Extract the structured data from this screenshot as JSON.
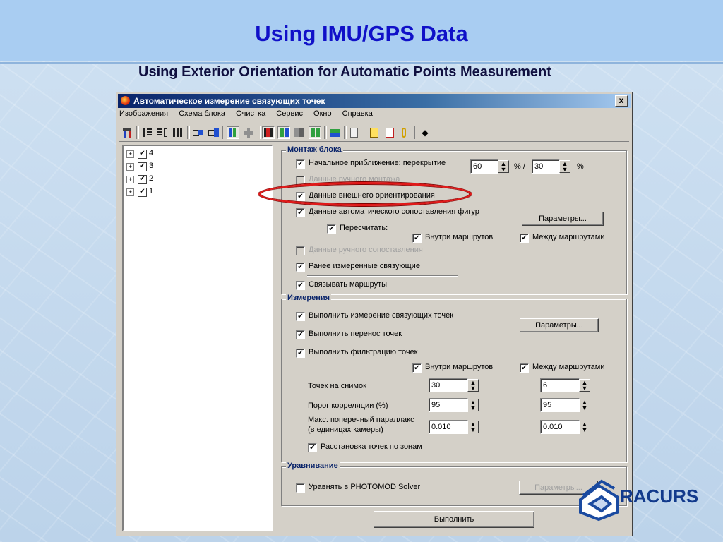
{
  "slide": {
    "title": "Using IMU/GPS Data",
    "subtitle": "Using Exterior Orientation for  Automatic Points Measurement"
  },
  "window": {
    "title": "Автоматическое измерение связующих точек",
    "close": "x",
    "menu": [
      "Изображения",
      "Схема блока",
      "Очистка",
      "Сервис",
      "Окно",
      "Справка"
    ]
  },
  "tree": [
    {
      "label": "4",
      "checked": true
    },
    {
      "label": "3",
      "checked": true
    },
    {
      "label": "2",
      "checked": true
    },
    {
      "label": "1",
      "checked": true
    }
  ],
  "mount": {
    "legend": "Монтаж блока",
    "initial_approx": "Начальное приближение: перекрытие",
    "overlap1": "60",
    "sep": "% /",
    "overlap2": "30",
    "pct": "%",
    "manual_mount": "Данные ручного монтажа",
    "exterior": "Данные внешнего ориентирования",
    "auto_match": "Данные автоматического сопоставления фигур",
    "params": "Параметры...",
    "recompute": "Пересчитать:",
    "within": "Внутри маршрутов",
    "between": "Между маршрутами",
    "manual_match": "Данные ручного сопоставления",
    "previous": "Ранее измеренные связующие",
    "link_routes": "Связывать маршруты"
  },
  "measure": {
    "legend": "Измерения",
    "do_measure": "Выполнить измерение связующих точек",
    "params": "Параметры...",
    "transfer": "Выполнить перенос точек",
    "filter": "Выполнить фильтрацию точек",
    "within": "Внутри маршрутов",
    "between": "Между маршрутами",
    "points_label": "Точек на снимок",
    "points_in": "30",
    "points_bt": "6",
    "corr_label": "Порог корреляции (%)",
    "corr_in": "95",
    "corr_bt": "95",
    "parallax_label1": "Макс. поперечный параллакс",
    "parallax_label2": "(в единицах камеры)",
    "parallax_in": "0.010",
    "parallax_bt": "0.010",
    "zones": "Расстановка точек по зонам"
  },
  "adjust": {
    "legend": "Уравнивание",
    "solver": "Уравнять в PHOTOMOD Solver",
    "params": "Параметры..."
  },
  "run": "Выполнить",
  "logo": {
    "text": "RACURS"
  },
  "colors": {
    "title_blue": "#1010c8",
    "highlight_red": "#e01818",
    "window_face": "#d4d0c8",
    "titlebar": "#0a246a"
  }
}
